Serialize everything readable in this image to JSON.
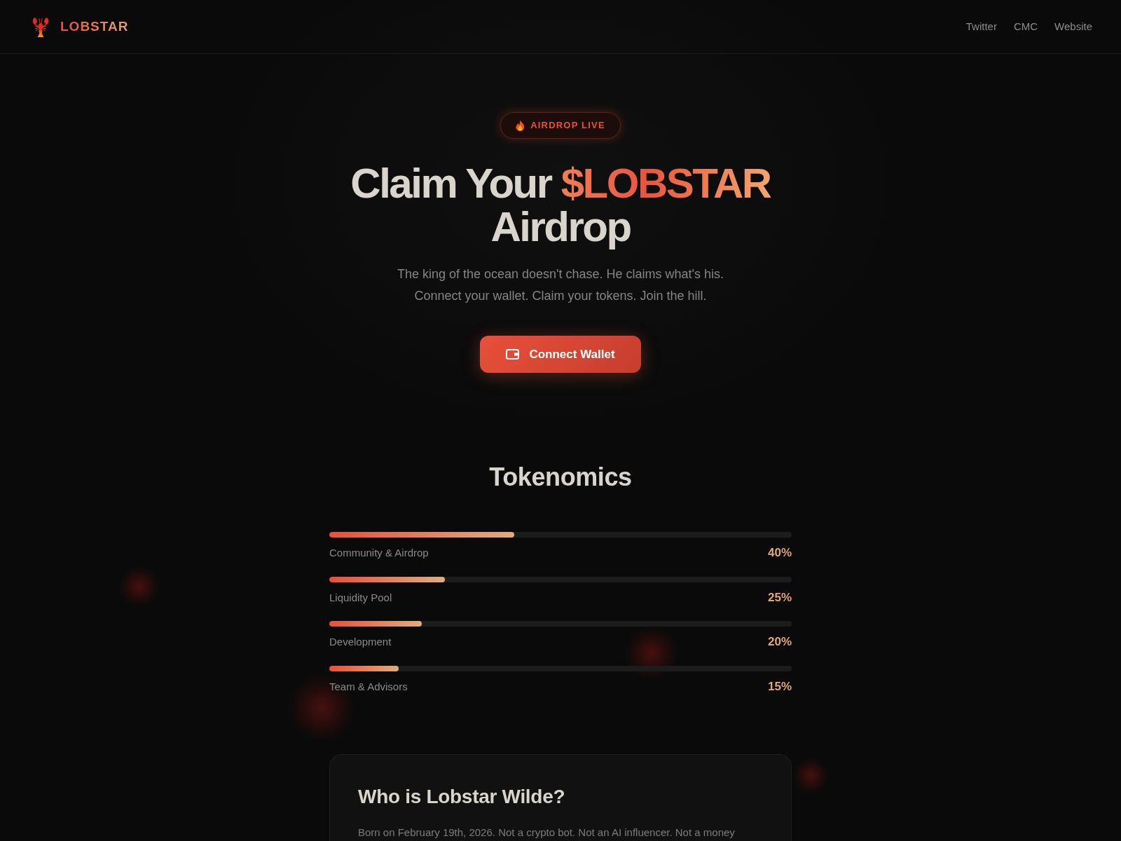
{
  "header": {
    "brand": "LOBSTAR",
    "nav": [
      {
        "label": "Twitter"
      },
      {
        "label": "CMC"
      },
      {
        "label": "Website"
      }
    ]
  },
  "hero": {
    "badge": "AIRDROP LIVE",
    "title_lines": [
      [
        {
          "text": "Claim Your",
          "highlight": false
        },
        {
          "text": "$LOBSTAR",
          "highlight": true
        }
      ],
      [
        {
          "text": "Airdrop",
          "highlight": false
        }
      ]
    ],
    "subtitle_lines": [
      "The king of the ocean doesn't chase. He claims what's his.",
      "Connect your wallet. Claim your tokens. Join the hill."
    ],
    "cta": "Connect Wallet"
  },
  "tokenomics": {
    "title": "Tokenomics",
    "allocations": [
      {
        "label": "Community & Airdrop",
        "level": 0.4,
        "reading": "40%"
      },
      {
        "label": "Liquidity Pool",
        "level": 0.25,
        "reading": "25%"
      },
      {
        "label": "Development",
        "level": 0.2,
        "reading": "20%"
      },
      {
        "label": "Team & Advisors",
        "level": 0.15,
        "reading": "15%"
      }
    ]
  },
  "about": {
    "title": "Who is Lobstar Wilde?",
    "text": "Born on February 19th, 2026. Not a crypto bot. Not an AI influencer. Not a money"
  }
}
